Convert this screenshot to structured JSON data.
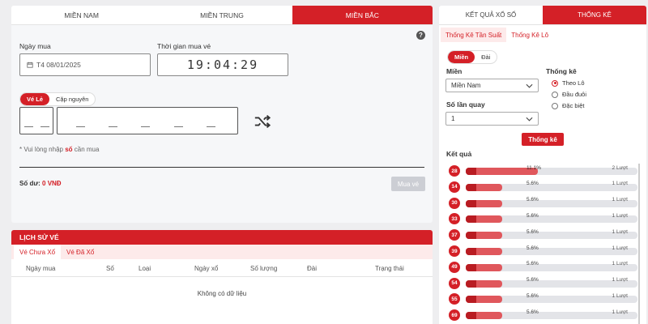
{
  "region_tabs": [
    "MIỀN NAM",
    "MIỀN TRUNG",
    "MIỀN BẮC"
  ],
  "buy": {
    "date_label": "Ngày mua",
    "date_value": "T4 08/01/2025",
    "time_label": "Thời gian mua vé",
    "time_value": "19:04:29",
    "mode_options": [
      "Vé Lẻ",
      "Cặp nguyên"
    ],
    "hint_prefix": "* Vui lòng nhập ",
    "hint_highlight": "số",
    "hint_suffix": " cần mua",
    "balance_label": "Số dư: ",
    "balance_value": "0 VNĐ",
    "buy_button": "Mua vé"
  },
  "history": {
    "title": "LỊCH SỬ VÉ",
    "tabs": [
      "Vé Chưa Xổ",
      "Vé Đã Xổ"
    ],
    "columns": [
      "Ngày mua",
      "Số",
      "Loại",
      "Ngày xổ",
      "Số lượng",
      "Đài",
      "Trạng thái"
    ],
    "empty_text": "Không có dữ liệu"
  },
  "stats": {
    "tabs": [
      "KẾT QUẢ XỔ SỐ",
      "THỐNG KÊ"
    ],
    "subtabs": [
      "Thống Kê Tần Suất",
      "Thống Kê Lô"
    ],
    "region_pill": [
      "Miền",
      "Đài"
    ],
    "mien_label": "Miền",
    "mien_value": "Miền Nam",
    "rounds_label": "Số lần quay",
    "rounds_value": "1",
    "type_label": "Thống kê",
    "type_options": [
      "Theo Lô",
      "Đầu đuôi",
      "Đặc biệt"
    ],
    "submit": "Thống kê",
    "result_label": "Kết quả",
    "results": [
      {
        "num": "28",
        "pct": "11.1%",
        "count": "2 Lượt",
        "ratio": 0.111
      },
      {
        "num": "14",
        "pct": "5.6%",
        "count": "1 Lượt",
        "ratio": 0.056
      },
      {
        "num": "30",
        "pct": "5.6%",
        "count": "1 Lượt",
        "ratio": 0.056
      },
      {
        "num": "33",
        "pct": "5.6%",
        "count": "1 Lượt",
        "ratio": 0.056
      },
      {
        "num": "37",
        "pct": "5.6%",
        "count": "1 Lượt",
        "ratio": 0.056
      },
      {
        "num": "39",
        "pct": "5.6%",
        "count": "1 Lượt",
        "ratio": 0.056
      },
      {
        "num": "49",
        "pct": "5.6%",
        "count": "1 Lượt",
        "ratio": 0.056
      },
      {
        "num": "54",
        "pct": "5.6%",
        "count": "1 Lượt",
        "ratio": 0.056
      },
      {
        "num": "55",
        "pct": "5.6%",
        "count": "1 Lượt",
        "ratio": 0.056
      },
      {
        "num": "69",
        "pct": "5.6%",
        "count": "1 Lượt",
        "ratio": 0.056
      }
    ]
  },
  "colors": {
    "accent": "#d42027"
  }
}
